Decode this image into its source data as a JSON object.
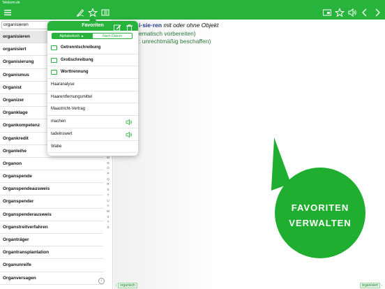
{
  "statusbar": {
    "carrier": "Telekom.de",
    "time": "",
    "battery": ""
  },
  "search": {
    "value": "organisieren"
  },
  "wordlist": [
    "organisieren",
    "organisiert",
    "Organisierung",
    "Organismus",
    "Organist",
    "Organizer",
    "Organklage",
    "Organkompetenz",
    "Organkredit",
    "Organleihe",
    "Organon",
    "Organspende",
    "Organspendeausweis",
    "Organspender",
    "Organspenderausweis",
    "Organstreitverfahren",
    "Organträger",
    "Organtransplantation",
    "Organunreife",
    "Organversagen"
  ],
  "alphabet": [
    "M",
    "N",
    "O",
    "P",
    "Q",
    "R",
    "S",
    "T",
    "U",
    "V",
    "W",
    "X",
    "Y",
    "Z"
  ],
  "info_icon": "i",
  "entry": {
    "headword": "i·sie·ren",
    "grammar": " mit oder ohne Objekt",
    "line2": "ematisch vorbereiten)",
    "line3": ": unrechtmäßig beschaffen)"
  },
  "bottom_nav": {
    "prev": "organisch",
    "next": "organisiert"
  },
  "popover": {
    "title": "Favoriten",
    "seg_alpha": "Alphabetisch ▲",
    "seg_date": "Nach Datum",
    "items": [
      {
        "label": "Getrenntschreibung",
        "folder": true,
        "sound": false
      },
      {
        "label": "Großschreibung",
        "folder": true,
        "sound": false
      },
      {
        "label": "Worttrennung",
        "folder": true,
        "sound": false
      },
      {
        "label": "Haaranalyse",
        "folder": false,
        "sound": false
      },
      {
        "label": "Haarentfernungsmittel",
        "folder": false,
        "sound": false
      },
      {
        "label": "Maastricht-Vertrag",
        "folder": false,
        "sound": false
      },
      {
        "label": "machen",
        "folder": false,
        "sound": true
      },
      {
        "label": "tadelnswert",
        "folder": false,
        "sound": true
      },
      {
        "label": "Wabe",
        "folder": false,
        "sound": false
      }
    ]
  },
  "callout": {
    "line1": "FAVORITEN",
    "line2": "VERWALTEN"
  },
  "colors": {
    "brand": "#28b43c",
    "callout": "#1fae2f"
  },
  "icons": {
    "left": [
      "menu-icon"
    ],
    "center": [
      "pen-icon",
      "star-icon",
      "book-icon"
    ],
    "right": [
      "window-icon",
      "star-icon",
      "speaker-icon",
      "back-icon",
      "forward-icon"
    ]
  }
}
